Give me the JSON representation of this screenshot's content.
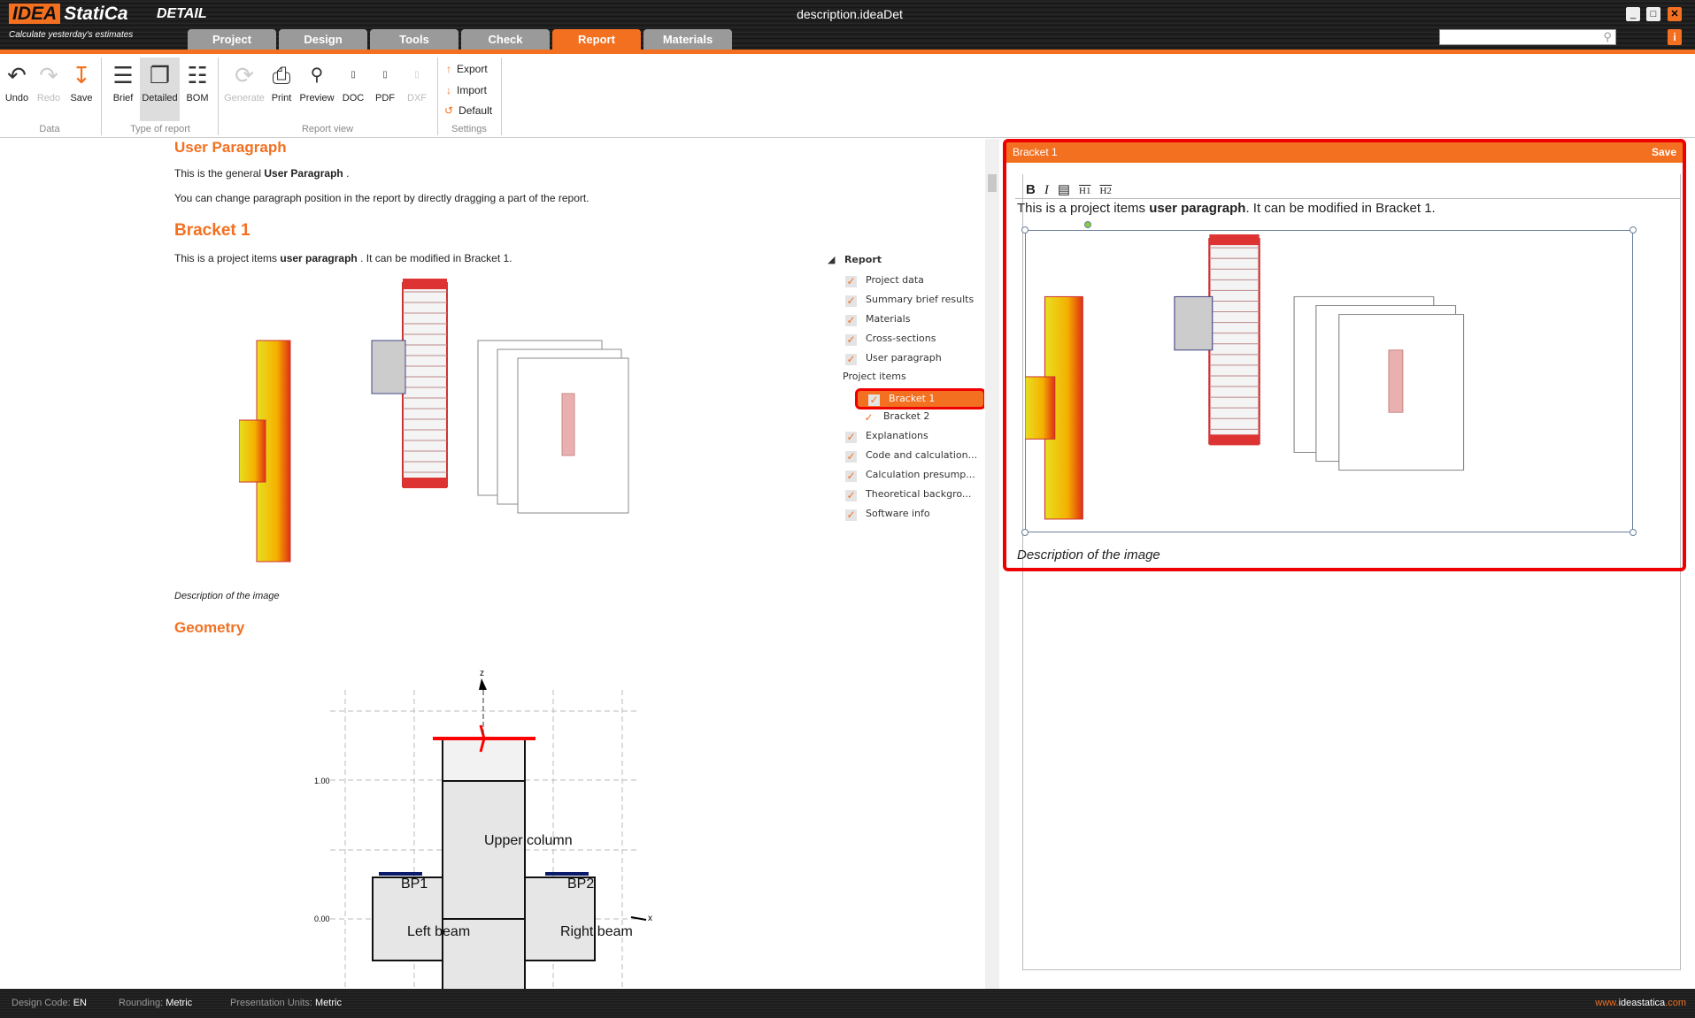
{
  "app": {
    "logo_text": "IDEA StatiCa",
    "product": "DETAIL",
    "tagline": "Calculate yesterday's estimates",
    "window_title": "description.ideaDet"
  },
  "tabs": [
    {
      "label": "Project"
    },
    {
      "label": "Design"
    },
    {
      "label": "Tools"
    },
    {
      "label": "Check"
    },
    {
      "label": "Report",
      "active": true
    },
    {
      "label": "Materials"
    }
  ],
  "window_controls": {
    "minimize": "_",
    "maximize": "□",
    "close": "✕",
    "info": "i"
  },
  "search": {
    "placeholder": "",
    "value": ""
  },
  "ribbon": {
    "data_group": {
      "label": "Data",
      "buttons": [
        "Undo",
        "Redo",
        "Save"
      ]
    },
    "type_group": {
      "label": "Type of report",
      "buttons": [
        "Brief",
        "Detailed",
        "BOM"
      ],
      "selected": "Detailed"
    },
    "view_group": {
      "label": "Report view",
      "buttons": [
        "Generate",
        "Print",
        "Preview",
        "DOC",
        "PDF",
        "DXF"
      ]
    },
    "settings_group": {
      "label": "Settings",
      "buttons": [
        "Export",
        "Import",
        "Default"
      ]
    }
  },
  "report": {
    "user_paragraph_title": "User Paragraph",
    "p1_pre": "This is the general ",
    "p1_bold": "User Paragraph",
    "p1_post": " .",
    "p2": "You can change paragraph position in the report by directly dragging a part of the report.",
    "bracket_title": "Bracket 1",
    "p3_pre": "This is a project items ",
    "p3_bold": "user paragraph",
    "p3_post": " . It can be modified in Bracket 1.",
    "image_caption": "Description of the image",
    "geometry_title": "Geometry",
    "geometry": {
      "axis_z": "z",
      "axis_x": "x",
      "tick_1": "1.00",
      "tick_0": "0.00",
      "labels": [
        "Upper column",
        "BP1",
        "BP2",
        "Left beam",
        "Right beam"
      ]
    }
  },
  "tree": {
    "root": "Report",
    "items_a": [
      "Project data",
      "Summary brief results",
      "Materials",
      "Cross-sections",
      "User paragraph"
    ],
    "group": "Project items",
    "project_items": [
      "Bracket 1",
      "Bracket 2"
    ],
    "selected": "Bracket 1",
    "items_b": [
      "Explanations",
      "Code and calculation...",
      "Calculation presump...",
      "Theoretical backgro...",
      "Software info"
    ]
  },
  "editor": {
    "title": "Bracket 1",
    "save_label": "Save",
    "toolbar": [
      "B",
      "I",
      "img",
      "H1",
      "H2"
    ],
    "text_pre": "This is a project items ",
    "text_bold": "user paragraph",
    "text_post": ". It can be modified in Bracket 1.",
    "caption": "Description of the image"
  },
  "status": {
    "design_code_label": "Design Code:",
    "design_code": "EN",
    "rounding_label": "Rounding:",
    "rounding": "Metric",
    "units_label": "Presentation Units:",
    "units": "Metric",
    "website_a": "www.",
    "website_b": "ideastatica",
    ".com": ".com",
    "website_c": ".com"
  },
  "colors": {
    "accent": "#f37021",
    "highlight": "#ee0000"
  }
}
